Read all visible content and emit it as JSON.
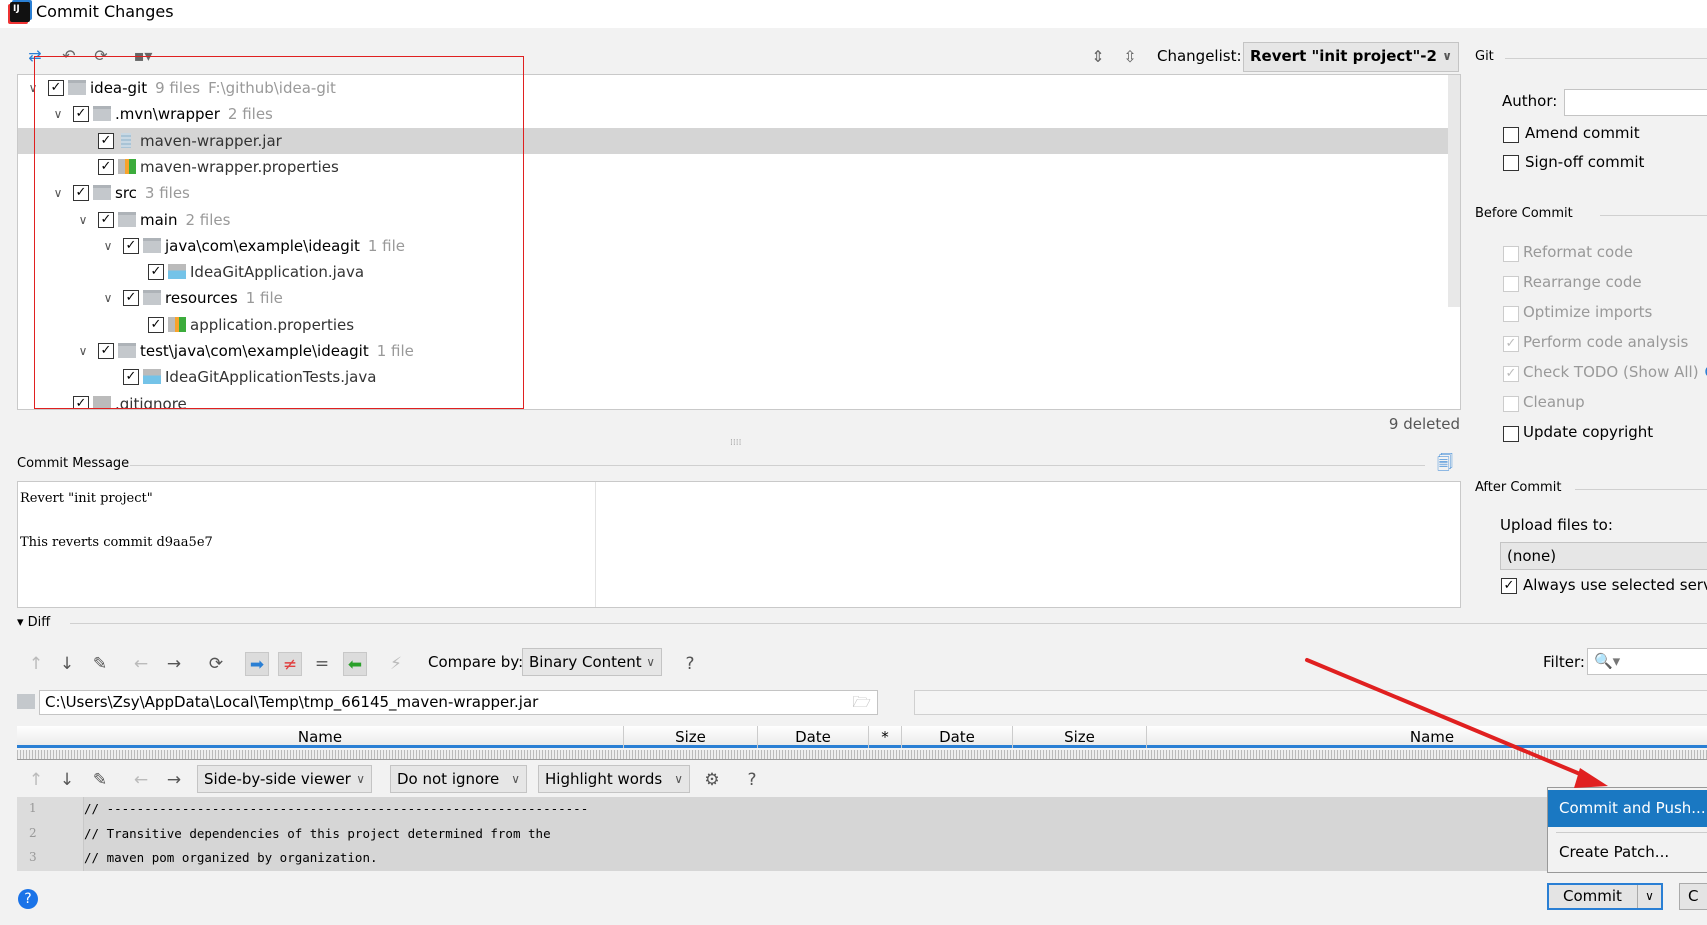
{
  "window": {
    "title": "Commit Changes"
  },
  "toolbar": {
    "changelist_label": "Changelist:",
    "changelist_value": "Revert \"init project\"-2"
  },
  "tree": [
    {
      "level": 0,
      "name": "idea-git",
      "count": "9 files",
      "extra": "F:\\github\\idea-git",
      "type": "module",
      "expanded": true,
      "checked": true
    },
    {
      "level": 1,
      "name": ".mvn\\wrapper",
      "count": "2 files",
      "type": "folder",
      "expanded": true,
      "checked": true
    },
    {
      "level": 2,
      "name": "maven-wrapper.jar",
      "type": "jar",
      "checked": true,
      "selected": true
    },
    {
      "level": 2,
      "name": "maven-wrapper.properties",
      "type": "props",
      "checked": true
    },
    {
      "level": 1,
      "name": "src",
      "count": "3 files",
      "type": "folder",
      "expanded": true,
      "checked": true
    },
    {
      "level": 2,
      "name": "main",
      "count": "2 files",
      "type": "folder",
      "expanded": true,
      "checked": true
    },
    {
      "level": 3,
      "name": "java\\com\\example\\ideagit",
      "count": "1 file",
      "type": "folder",
      "expanded": true,
      "checked": true
    },
    {
      "level": 4,
      "name": "IdeaGitApplication.java",
      "type": "java",
      "checked": true
    },
    {
      "level": 3,
      "name": "resources",
      "count": "1 file",
      "type": "folder",
      "expanded": true,
      "checked": true
    },
    {
      "level": 4,
      "name": "application.properties",
      "type": "props",
      "checked": true
    },
    {
      "level": 2,
      "name": "test\\java\\com\\example\\ideagit",
      "count": "1 file",
      "type": "folder",
      "expanded": true,
      "checked": true
    },
    {
      "level": 3,
      "name": "IdeaGitApplicationTests.java",
      "type": "java",
      "checked": true
    },
    {
      "level": 1,
      "name": ".gitignore",
      "type": "txt",
      "checked": true
    }
  ],
  "status": "9 deleted",
  "commit_message": {
    "label": "Commit Message",
    "text": "Revert \"init project\"\n\nThis reverts commit d9aa5e7"
  },
  "git": {
    "label": "Git",
    "author_label": "Author:",
    "author_value": "",
    "amend": {
      "label": "Amend commit",
      "checked": false
    },
    "signoff": {
      "label": "Sign-off commit",
      "checked": false
    }
  },
  "before_commit": {
    "label": "Before Commit",
    "options": [
      {
        "label": "Reformat code",
        "checked": false,
        "disabled": true
      },
      {
        "label": "Rearrange code",
        "checked": false,
        "disabled": true
      },
      {
        "label": "Optimize imports",
        "checked": false,
        "disabled": true
      },
      {
        "label": "Perform code analysis",
        "checked": true,
        "disabled": true
      },
      {
        "label": "Check TODO (Show All)",
        "checked": true,
        "disabled": true,
        "link": "C"
      },
      {
        "label": "Cleanup",
        "checked": false,
        "disabled": true
      },
      {
        "label": "Update copyright",
        "checked": false,
        "disabled": false
      }
    ]
  },
  "after_commit": {
    "label": "After Commit",
    "upload_label": "Upload files to:",
    "upload_value": "(none)",
    "always_label": "Always use selected serve",
    "always_checked": true
  },
  "diff": {
    "label": "Diff",
    "compare_label": "Compare by:",
    "compare_value": "Binary Content",
    "help": "?",
    "filter_label": "Filter:",
    "path": "C:\\Users\\Zsy\\AppData\\Local\\Temp\\tmp_66145_maven-wrapper.jar",
    "columns": [
      "Name",
      "Size",
      "Date",
      "*",
      "Date",
      "Size",
      "Name"
    ],
    "viewer": "Side-by-side viewer",
    "ignore": "Do not ignore",
    "highlight": "Highlight words",
    "lines": [
      {
        "n": "1",
        "text": "// ----------------------------------------------------------------"
      },
      {
        "n": "2",
        "text": "// Transitive dependencies of this project determined from the"
      },
      {
        "n": "3",
        "text": "// maven pom organized by organization."
      }
    ]
  },
  "popup": {
    "items": [
      "Commit and Push...",
      "Create Patch..."
    ]
  },
  "buttons": {
    "commit": "Commit",
    "cancel": "C",
    "help": "?"
  },
  "colors": {
    "accent": "#2a7fd4",
    "annotation": "#e02020"
  }
}
